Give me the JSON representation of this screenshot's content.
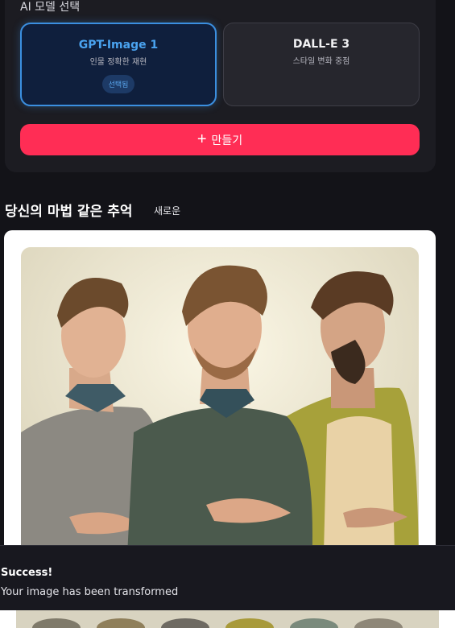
{
  "model_section": {
    "label": "AI 모델 선택",
    "models": [
      {
        "name": "GPT-Image 1",
        "desc": "인물 정확한 재현",
        "badge": "선택됨"
      },
      {
        "name": "DALL-E 3",
        "desc": "스타일 변화 중점"
      }
    ],
    "create_button": "만들기"
  },
  "gallery": {
    "title": "당신의 마법 같은 추억",
    "new_label": "새로운"
  },
  "toast": {
    "title": "Success!",
    "message": "Your image has been transformed"
  },
  "colors": {
    "accent": "#ff2d55",
    "selected_border": "#3b8fe0",
    "background": "#131318"
  }
}
